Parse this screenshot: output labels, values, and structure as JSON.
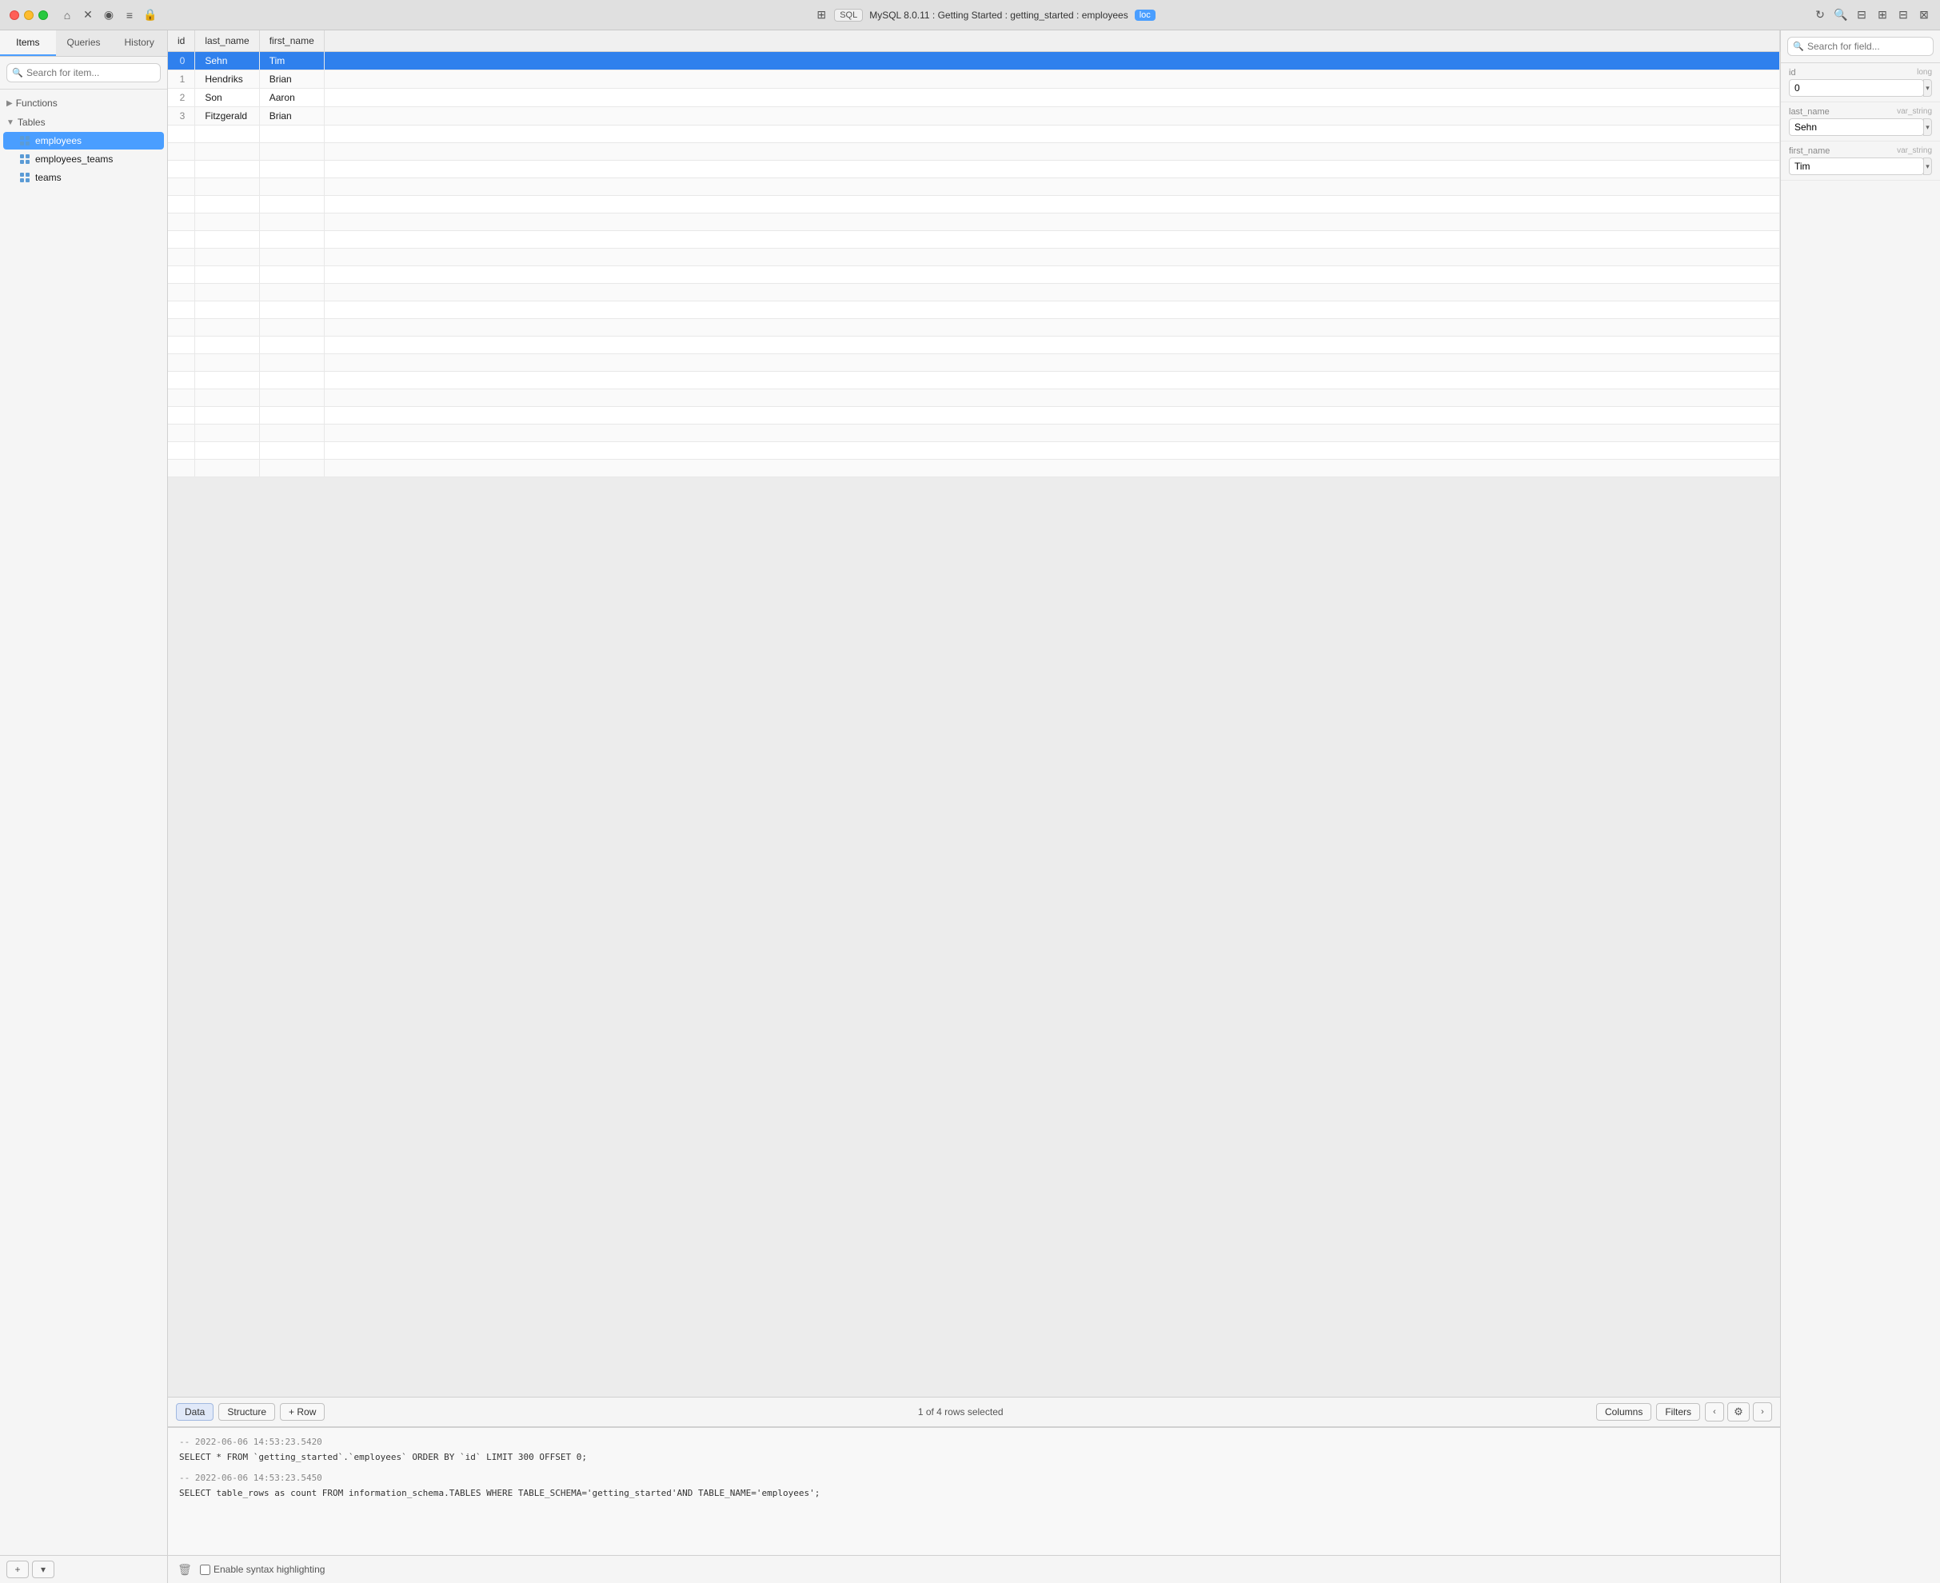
{
  "titlebar": {
    "sql_badge": "SQL",
    "title": "MySQL 8.0.11 : Getting Started : getting_started : employees",
    "loc_badge": "loc"
  },
  "sidebar": {
    "tabs": [
      {
        "label": "Items",
        "active": true
      },
      {
        "label": "Queries",
        "active": false
      },
      {
        "label": "History",
        "active": false
      }
    ],
    "search_placeholder": "Search for item...",
    "sections": [
      {
        "label": "Functions",
        "expanded": false
      },
      {
        "label": "Tables",
        "expanded": true
      }
    ],
    "tables": [
      {
        "name": "employees",
        "active": true
      },
      {
        "name": "employees_teams",
        "active": false
      },
      {
        "name": "teams",
        "active": false
      }
    ],
    "add_label": "+",
    "dropdown_label": "▾"
  },
  "table": {
    "columns": [
      "id",
      "last_name",
      "first_name"
    ],
    "rows": [
      {
        "id": "0",
        "last_name": "Sehn",
        "first_name": "Tim",
        "selected": true
      },
      {
        "id": "1",
        "last_name": "Hendriks",
        "first_name": "Brian",
        "selected": false
      },
      {
        "id": "2",
        "last_name": "Son",
        "first_name": "Aaron",
        "selected": false
      },
      {
        "id": "3",
        "last_name": "Fitzgerald",
        "first_name": "Brian",
        "selected": false
      }
    ],
    "empty_rows": 20
  },
  "toolbar": {
    "data_label": "Data",
    "structure_label": "Structure",
    "add_row_label": "+ Row",
    "status": "1 of 4 rows selected",
    "columns_label": "Columns",
    "filters_label": "Filters",
    "gear_icon": "⚙"
  },
  "sql_log": {
    "entries": [
      {
        "comment": "-- 2022-06-06 14:53:23.5420",
        "sql": "SELECT * FROM `getting_started`.`employees` ORDER BY `id` LIMIT 300 OFFSET 0;"
      },
      {
        "comment": "-- 2022-06-06 14:53:23.5450",
        "sql": "SELECT table_rows as count FROM information_schema.TABLES WHERE TABLE_SCHEMA='getting_started'AND TABLE_NAME='employees';"
      }
    ],
    "enable_syntax_highlighting": "Enable syntax highlighting"
  },
  "right_panel": {
    "search_placeholder": "Search for field...",
    "fields": [
      {
        "name": "id",
        "type": "long",
        "value": "0"
      },
      {
        "name": "last_name",
        "type": "var_string",
        "value": "Sehn"
      },
      {
        "name": "first_name",
        "type": "var_string",
        "value": "Tim"
      }
    ]
  }
}
